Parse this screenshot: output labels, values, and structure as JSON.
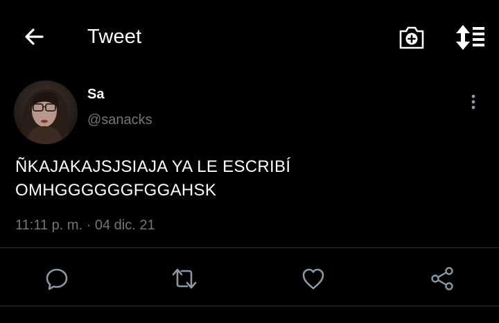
{
  "header": {
    "title": "Tweet",
    "back_icon": "arrow-left-icon",
    "camera_icon": "camera-add-icon",
    "sort_icon": "sort-lines-icon"
  },
  "tweet": {
    "author_name": "Sa",
    "author_handle": "@sanacks",
    "text_lines": [
      "ÑKAJAKAJSJSIAJA YA LE ESCRIBÍ",
      "OMHGGGGGGFGGAHSK"
    ],
    "timestamp": "11:11 p. m. · 04 dic. 21",
    "more_icon": "more-vertical-icon"
  },
  "actions": [
    {
      "name": "reply",
      "icon": "reply-icon"
    },
    {
      "name": "retweet",
      "icon": "retweet-icon"
    },
    {
      "name": "like",
      "icon": "heart-icon"
    },
    {
      "name": "share",
      "icon": "share-icon"
    }
  ],
  "colors": {
    "background": "#000000",
    "text": "#ffffff",
    "secondary_text": "#71767b",
    "divider": "#2f3336",
    "icon": "#8b98a5"
  }
}
